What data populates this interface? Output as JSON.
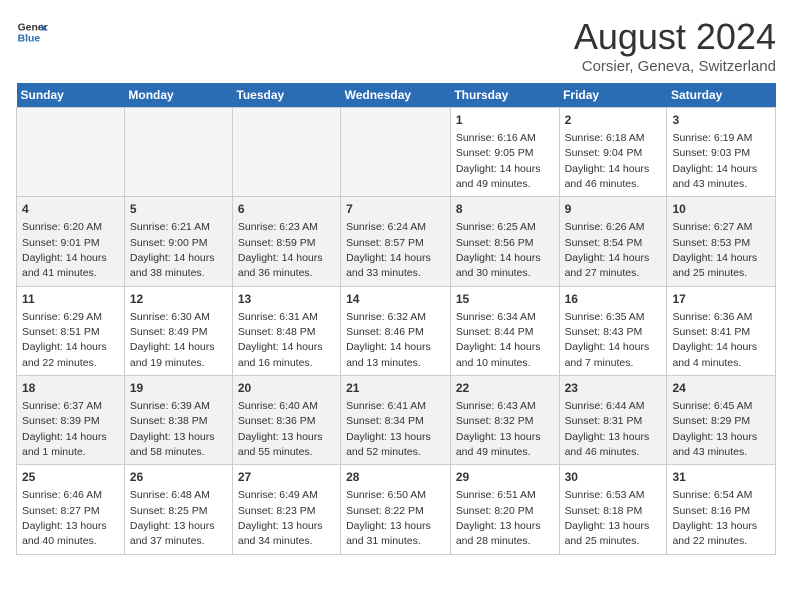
{
  "header": {
    "logo_line1": "General",
    "logo_line2": "Blue",
    "month_title": "August 2024",
    "location": "Corsier, Geneva, Switzerland"
  },
  "days_of_week": [
    "Sunday",
    "Monday",
    "Tuesday",
    "Wednesday",
    "Thursday",
    "Friday",
    "Saturday"
  ],
  "weeks": [
    [
      {
        "num": "",
        "info": ""
      },
      {
        "num": "",
        "info": ""
      },
      {
        "num": "",
        "info": ""
      },
      {
        "num": "",
        "info": ""
      },
      {
        "num": "1",
        "info": "Sunrise: 6:16 AM\nSunset: 9:05 PM\nDaylight: 14 hours and 49 minutes."
      },
      {
        "num": "2",
        "info": "Sunrise: 6:18 AM\nSunset: 9:04 PM\nDaylight: 14 hours and 46 minutes."
      },
      {
        "num": "3",
        "info": "Sunrise: 6:19 AM\nSunset: 9:03 PM\nDaylight: 14 hours and 43 minutes."
      }
    ],
    [
      {
        "num": "4",
        "info": "Sunrise: 6:20 AM\nSunset: 9:01 PM\nDaylight: 14 hours and 41 minutes."
      },
      {
        "num": "5",
        "info": "Sunrise: 6:21 AM\nSunset: 9:00 PM\nDaylight: 14 hours and 38 minutes."
      },
      {
        "num": "6",
        "info": "Sunrise: 6:23 AM\nSunset: 8:59 PM\nDaylight: 14 hours and 36 minutes."
      },
      {
        "num": "7",
        "info": "Sunrise: 6:24 AM\nSunset: 8:57 PM\nDaylight: 14 hours and 33 minutes."
      },
      {
        "num": "8",
        "info": "Sunrise: 6:25 AM\nSunset: 8:56 PM\nDaylight: 14 hours and 30 minutes."
      },
      {
        "num": "9",
        "info": "Sunrise: 6:26 AM\nSunset: 8:54 PM\nDaylight: 14 hours and 27 minutes."
      },
      {
        "num": "10",
        "info": "Sunrise: 6:27 AM\nSunset: 8:53 PM\nDaylight: 14 hours and 25 minutes."
      }
    ],
    [
      {
        "num": "11",
        "info": "Sunrise: 6:29 AM\nSunset: 8:51 PM\nDaylight: 14 hours and 22 minutes."
      },
      {
        "num": "12",
        "info": "Sunrise: 6:30 AM\nSunset: 8:49 PM\nDaylight: 14 hours and 19 minutes."
      },
      {
        "num": "13",
        "info": "Sunrise: 6:31 AM\nSunset: 8:48 PM\nDaylight: 14 hours and 16 minutes."
      },
      {
        "num": "14",
        "info": "Sunrise: 6:32 AM\nSunset: 8:46 PM\nDaylight: 14 hours and 13 minutes."
      },
      {
        "num": "15",
        "info": "Sunrise: 6:34 AM\nSunset: 8:44 PM\nDaylight: 14 hours and 10 minutes."
      },
      {
        "num": "16",
        "info": "Sunrise: 6:35 AM\nSunset: 8:43 PM\nDaylight: 14 hours and 7 minutes."
      },
      {
        "num": "17",
        "info": "Sunrise: 6:36 AM\nSunset: 8:41 PM\nDaylight: 14 hours and 4 minutes."
      }
    ],
    [
      {
        "num": "18",
        "info": "Sunrise: 6:37 AM\nSunset: 8:39 PM\nDaylight: 14 hours and 1 minute."
      },
      {
        "num": "19",
        "info": "Sunrise: 6:39 AM\nSunset: 8:38 PM\nDaylight: 13 hours and 58 minutes."
      },
      {
        "num": "20",
        "info": "Sunrise: 6:40 AM\nSunset: 8:36 PM\nDaylight: 13 hours and 55 minutes."
      },
      {
        "num": "21",
        "info": "Sunrise: 6:41 AM\nSunset: 8:34 PM\nDaylight: 13 hours and 52 minutes."
      },
      {
        "num": "22",
        "info": "Sunrise: 6:43 AM\nSunset: 8:32 PM\nDaylight: 13 hours and 49 minutes."
      },
      {
        "num": "23",
        "info": "Sunrise: 6:44 AM\nSunset: 8:31 PM\nDaylight: 13 hours and 46 minutes."
      },
      {
        "num": "24",
        "info": "Sunrise: 6:45 AM\nSunset: 8:29 PM\nDaylight: 13 hours and 43 minutes."
      }
    ],
    [
      {
        "num": "25",
        "info": "Sunrise: 6:46 AM\nSunset: 8:27 PM\nDaylight: 13 hours and 40 minutes."
      },
      {
        "num": "26",
        "info": "Sunrise: 6:48 AM\nSunset: 8:25 PM\nDaylight: 13 hours and 37 minutes."
      },
      {
        "num": "27",
        "info": "Sunrise: 6:49 AM\nSunset: 8:23 PM\nDaylight: 13 hours and 34 minutes."
      },
      {
        "num": "28",
        "info": "Sunrise: 6:50 AM\nSunset: 8:22 PM\nDaylight: 13 hours and 31 minutes."
      },
      {
        "num": "29",
        "info": "Sunrise: 6:51 AM\nSunset: 8:20 PM\nDaylight: 13 hours and 28 minutes."
      },
      {
        "num": "30",
        "info": "Sunrise: 6:53 AM\nSunset: 8:18 PM\nDaylight: 13 hours and 25 minutes."
      },
      {
        "num": "31",
        "info": "Sunrise: 6:54 AM\nSunset: 8:16 PM\nDaylight: 13 hours and 22 minutes."
      }
    ]
  ]
}
